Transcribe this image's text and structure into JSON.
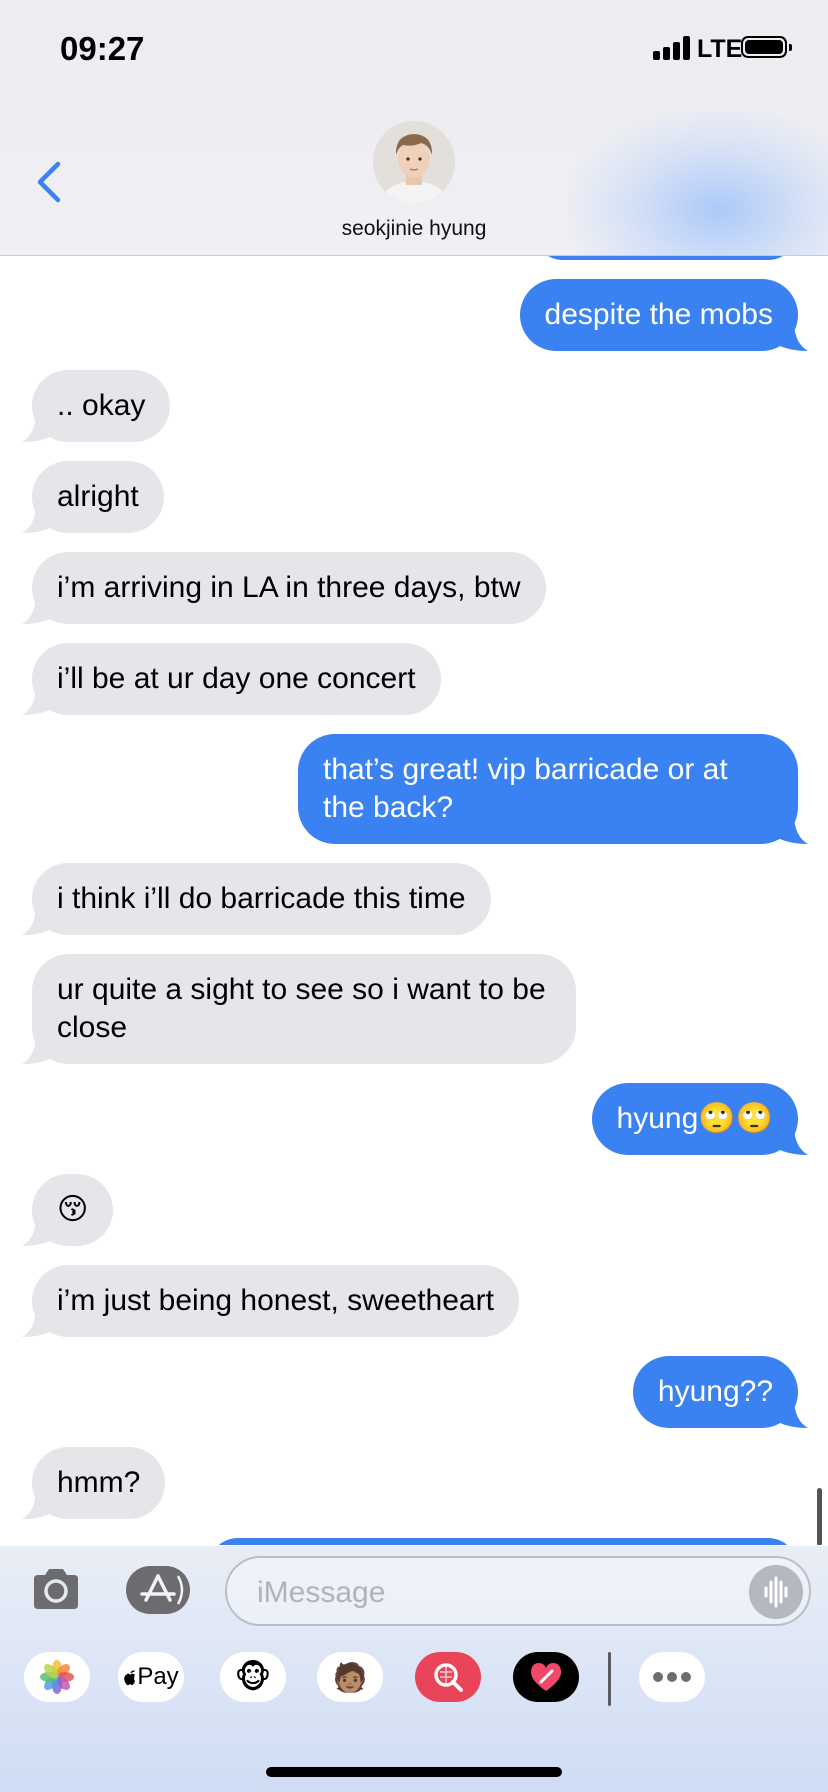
{
  "status_bar": {
    "time": "09:27",
    "network": "LTE"
  },
  "header": {
    "contact_name": "seokjinie hyung",
    "back_icon": "chevron-left-icon",
    "accent_color": "#3a82f2"
  },
  "messages": [
    {
      "direction": "out",
      "text": "despite the mobs"
    },
    {
      "direction": "in",
      "text": ".. okay"
    },
    {
      "direction": "in",
      "text": "alright"
    },
    {
      "direction": "in",
      "text": "i’m arriving in LA in three days, btw"
    },
    {
      "direction": "in",
      "text": "i’ll be at ur day one concert"
    },
    {
      "direction": "out",
      "text": "that’s great! vip barricade or at the back?"
    },
    {
      "direction": "in",
      "text": "i think i’ll do barricade this time"
    },
    {
      "direction": "in",
      "text": "ur quite a sight to see so i want to be close"
    },
    {
      "direction": "out",
      "text": "hyung🙄🙄"
    },
    {
      "direction": "in",
      "text": "😚"
    },
    {
      "direction": "in",
      "text": "i’m just being honest, sweetheart"
    },
    {
      "direction": "out",
      "text": "hyung??"
    },
    {
      "direction": "in",
      "text": "hmm?"
    }
  ],
  "colors": {
    "incoming_bubble": "#e5e5ea",
    "outgoing_bubble": "#3a82f2"
  },
  "input": {
    "placeholder": "iMessage",
    "value": ""
  },
  "app_drawer": [
    {
      "icon": "photos-icon"
    },
    {
      "icon": "apple-pay-icon",
      "label": "Pay"
    },
    {
      "icon": "animoji-monkey-icon"
    },
    {
      "icon": "memoji-icon"
    },
    {
      "icon": "image-search-icon"
    },
    {
      "icon": "digital-touch-heart-icon"
    },
    {
      "icon": "more-icon"
    }
  ]
}
